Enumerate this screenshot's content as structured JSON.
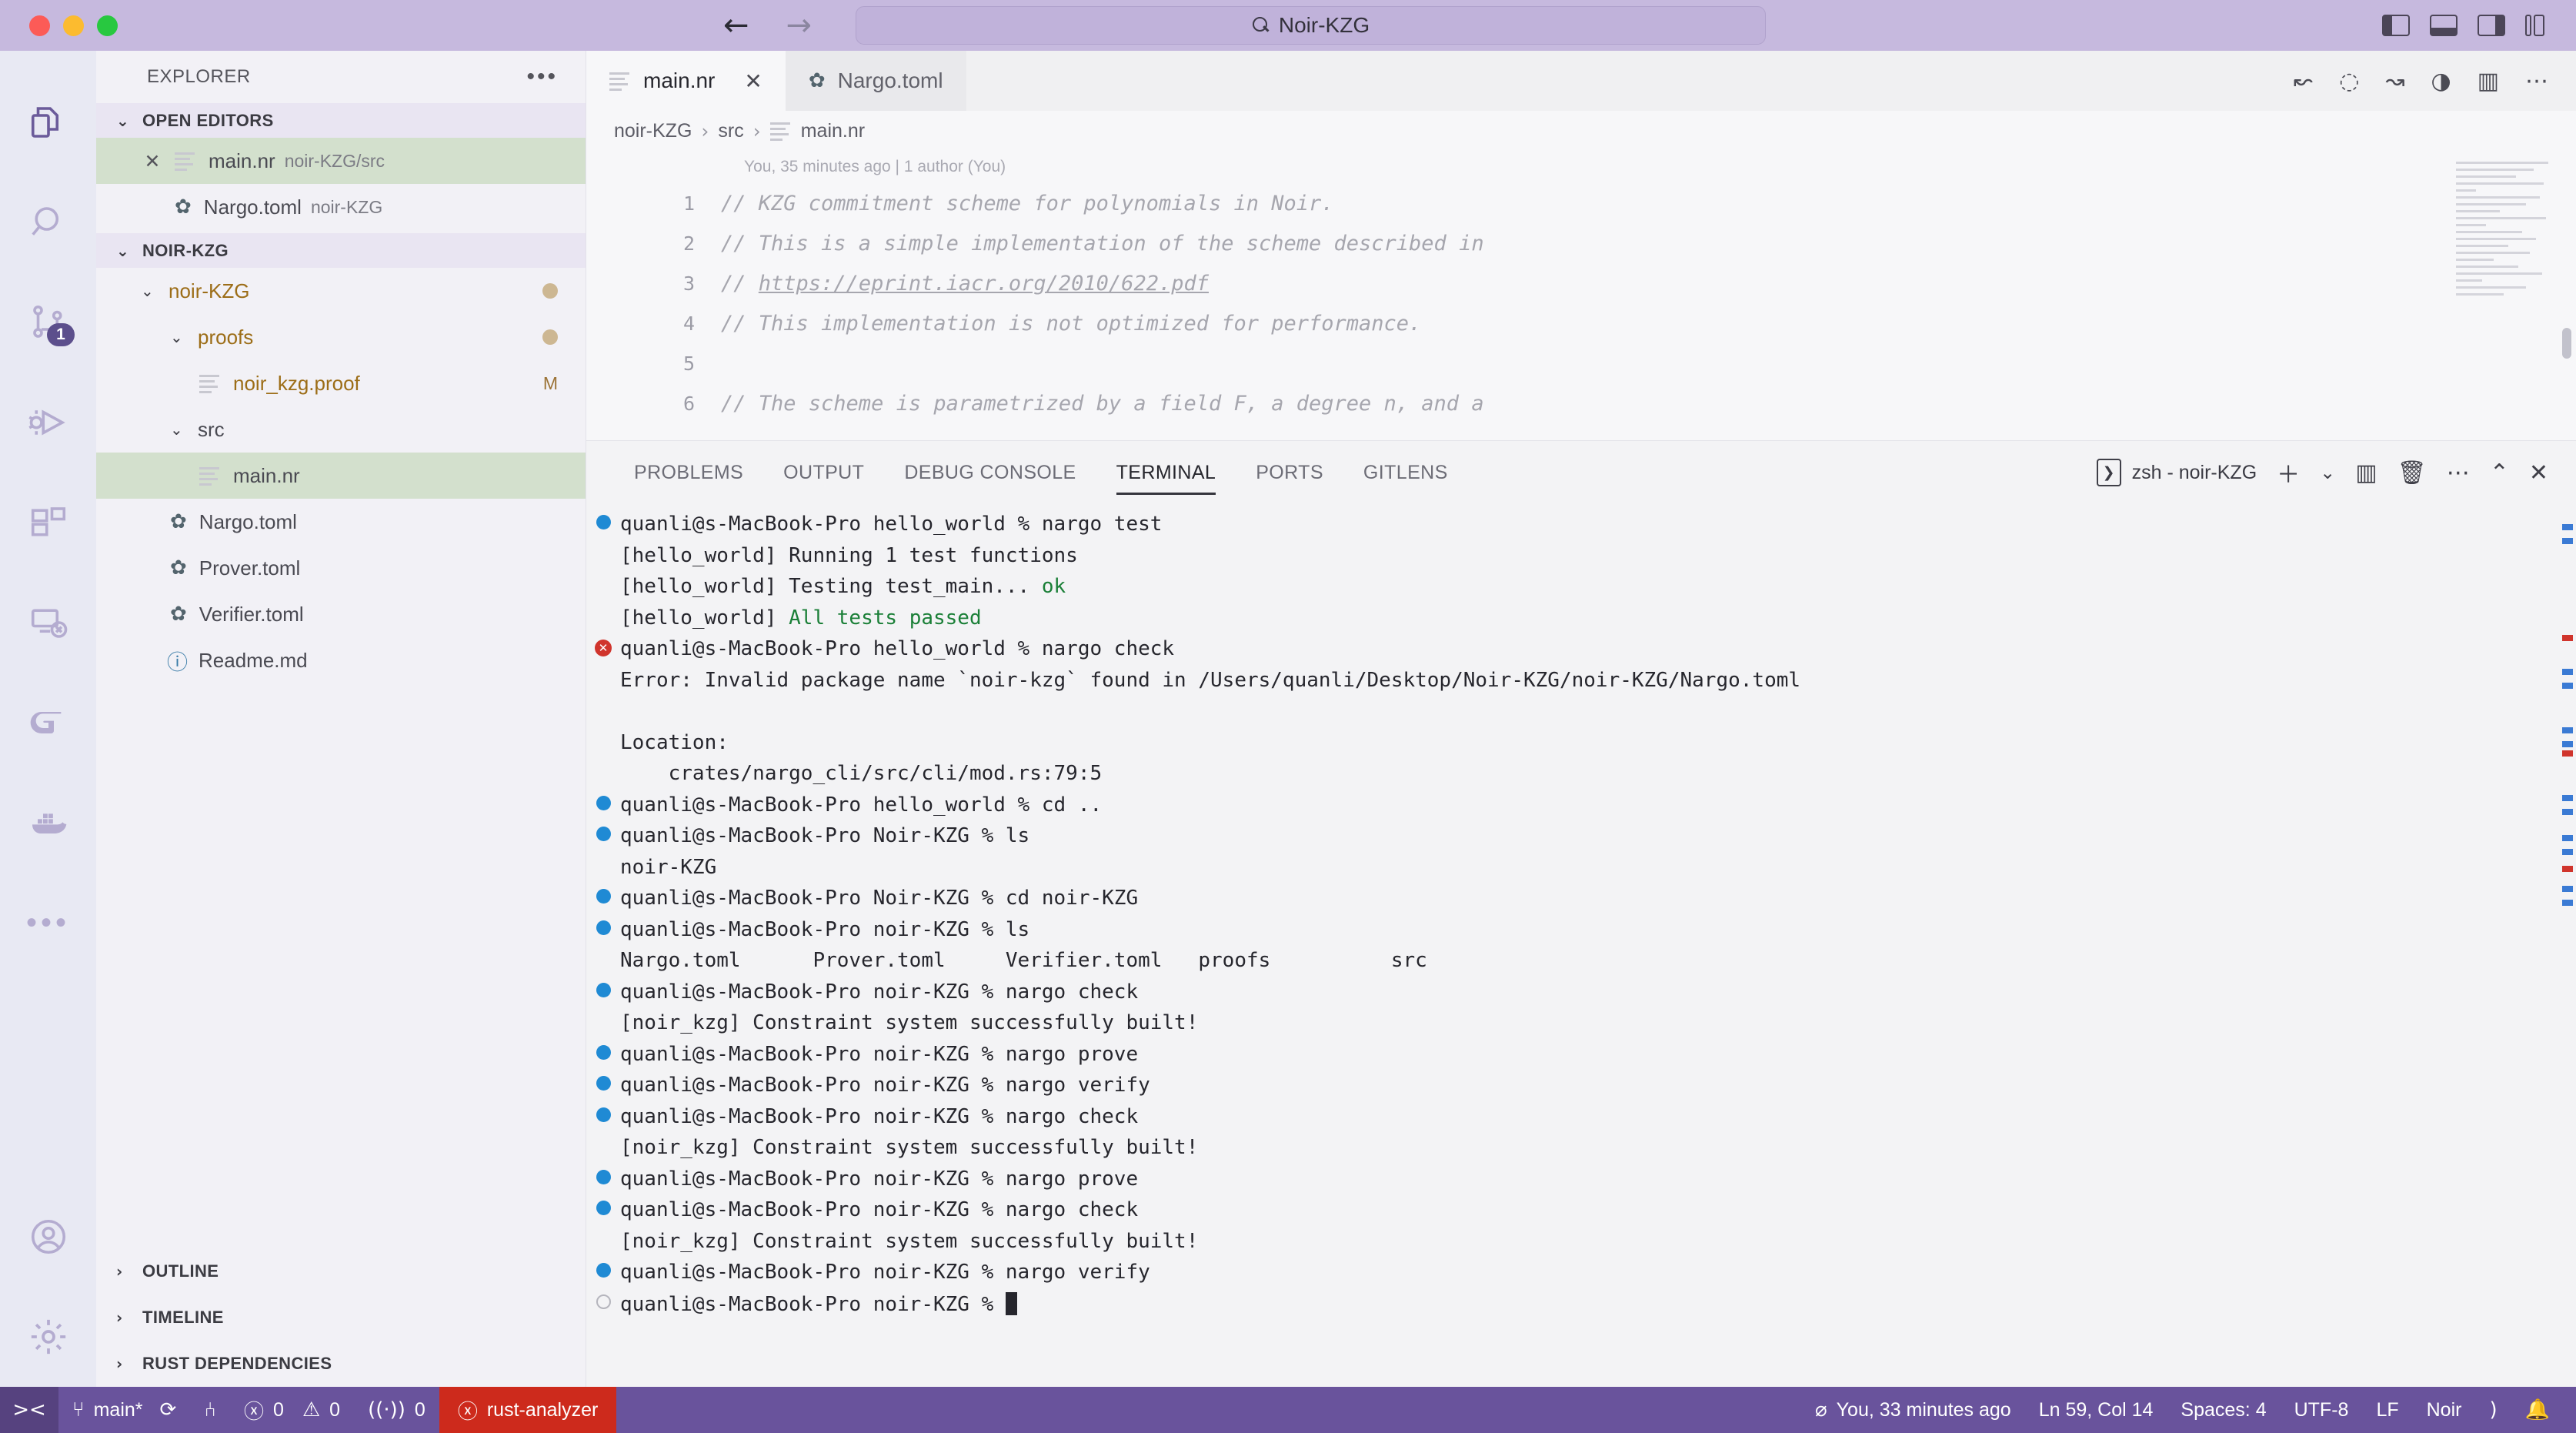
{
  "titlebar": {
    "command_center_text": "Noir-KZG",
    "search_icon": "search-icon",
    "back_arrow": "←",
    "forward_arrow": "→"
  },
  "activitybar": {
    "items": [
      {
        "name": "explorer",
        "icon": "files-icon",
        "badge": ""
      },
      {
        "name": "search",
        "icon": "search-icon",
        "badge": ""
      },
      {
        "name": "source-control",
        "icon": "source-control-icon",
        "badge": "1"
      },
      {
        "name": "run-and-debug",
        "icon": "debug-icon",
        "badge": ""
      },
      {
        "name": "extensions",
        "icon": "extensions-icon",
        "badge": ""
      },
      {
        "name": "remote-explorer",
        "icon": "remote-explorer-icon",
        "badge": ""
      },
      {
        "name": "gitlens",
        "icon": "gitlens-icon",
        "badge": ""
      },
      {
        "name": "docker",
        "icon": "docker-icon",
        "badge": ""
      },
      {
        "name": "more-views",
        "icon": "ellipsis-icon",
        "badge": ""
      }
    ],
    "bottom_items": [
      {
        "name": "accounts",
        "icon": "account-icon"
      },
      {
        "name": "manage",
        "icon": "gear-icon"
      }
    ]
  },
  "sidebar": {
    "title": "EXPLORER",
    "more_actions": "…",
    "open_editors": {
      "label": "OPEN EDITORS",
      "items": [
        {
          "name": "main.nr",
          "path": "noir-KZG/src",
          "icon": "file-icon",
          "selected": true,
          "closeable": true
        },
        {
          "name": "Nargo.toml",
          "path": "noir-KZG",
          "icon": "gear-icon",
          "selected": false,
          "closeable": false
        }
      ]
    },
    "workspace": {
      "label": "NOIR-KZG",
      "tree": [
        {
          "label": "noir-KZG",
          "type": "folder",
          "depth": 0,
          "expanded": true,
          "color": "amber",
          "dirty": true
        },
        {
          "label": "proofs",
          "type": "folder",
          "depth": 1,
          "expanded": true,
          "color": "amber",
          "dirty": true
        },
        {
          "label": "noir_kzg.proof",
          "type": "file",
          "depth": 2,
          "icon": "file-icon",
          "color": "amber",
          "git_status": "M"
        },
        {
          "label": "src",
          "type": "folder",
          "depth": 1,
          "expanded": true,
          "color": "grey"
        },
        {
          "label": "main.nr",
          "type": "file",
          "depth": 2,
          "icon": "file-icon",
          "color": "grey",
          "selected": true
        },
        {
          "label": "Nargo.toml",
          "type": "file",
          "depth": 1,
          "icon": "gear-icon",
          "color": "grey"
        },
        {
          "label": "Prover.toml",
          "type": "file",
          "depth": 1,
          "icon": "gear-icon",
          "color": "grey"
        },
        {
          "label": "Verifier.toml",
          "type": "file",
          "depth": 1,
          "icon": "gear-icon",
          "color": "grey"
        },
        {
          "label": "Readme.md",
          "type": "file",
          "depth": 1,
          "icon": "info-icon",
          "color": "grey"
        }
      ]
    },
    "collapsed_sections": [
      "OUTLINE",
      "TIMELINE",
      "RUST DEPENDENCIES"
    ]
  },
  "editor": {
    "tabs": [
      {
        "label": "main.nr",
        "icon": "file-icon",
        "active": true,
        "closeable": true
      },
      {
        "label": "Nargo.toml",
        "icon": "gear-icon",
        "active": false,
        "closeable": false
      }
    ],
    "tab_actions": [
      "go-back-icon",
      "circle-icon",
      "go-forward-icon",
      "history-icon",
      "split-editor-icon",
      "more-actions-icon"
    ],
    "breadcrumb": [
      "noir-KZG",
      "src",
      "main.nr"
    ],
    "breadcrumb_separator": "›",
    "blame": "You, 35 minutes ago | 1 author (You)",
    "lines": [
      {
        "num": "1",
        "text": "// KZG commitment scheme for polynomials in Noir.",
        "link": ""
      },
      {
        "num": "2",
        "text": "// This is a simple implementation of the scheme described in",
        "link": ""
      },
      {
        "num": "3",
        "text": "// ",
        "link": "https://eprint.iacr.org/2010/622.pdf"
      },
      {
        "num": "4",
        "text": "// This implementation is not optimized for performance.",
        "link": ""
      },
      {
        "num": "5",
        "text": "",
        "link": ""
      },
      {
        "num": "6",
        "text": "// The scheme is parametrized by a field F, a degree n, and a",
        "link": ""
      }
    ]
  },
  "panel": {
    "tabs": [
      {
        "label": "PROBLEMS",
        "active": false
      },
      {
        "label": "OUTPUT",
        "active": false
      },
      {
        "label": "DEBUG CONSOLE",
        "active": false
      },
      {
        "label": "TERMINAL",
        "active": true
      },
      {
        "label": "PORTS",
        "active": false
      },
      {
        "label": "GITLENS",
        "active": false
      }
    ],
    "terminal_name": "zsh - noir-KZG",
    "actions": [
      "new-terminal-icon",
      "chevron-down-icon",
      "split-terminal-icon",
      "trash-icon",
      "more-actions-icon",
      "chevron-up-icon",
      "close-icon"
    ],
    "terminal_lines": [
      {
        "marker": "blue",
        "text": "quanli@s-MacBook-Pro hello_world % nargo test"
      },
      {
        "marker": "none",
        "text": "[hello_world] Running 1 test functions"
      },
      {
        "marker": "none",
        "text": "[hello_world] Testing test_main... ",
        "green_tail": "ok"
      },
      {
        "marker": "none",
        "text": "[hello_world] ",
        "green_tail": "All tests passed"
      },
      {
        "marker": "error",
        "text": "quanli@s-MacBook-Pro hello_world % nargo check"
      },
      {
        "marker": "none",
        "text": "Error: Invalid package name `noir-kzg` found in /Users/quanli/Desktop/Noir-KZG/noir-KZG/Nargo.toml"
      },
      {
        "marker": "none",
        "text": ""
      },
      {
        "marker": "none",
        "text": "Location:"
      },
      {
        "marker": "none",
        "text": "    crates/nargo_cli/src/cli/mod.rs:79:5"
      },
      {
        "marker": "blue",
        "text": "quanli@s-MacBook-Pro hello_world % cd .."
      },
      {
        "marker": "blue",
        "text": "quanli@s-MacBook-Pro Noir-KZG % ls"
      },
      {
        "marker": "none",
        "text": "noir-KZG"
      },
      {
        "marker": "blue",
        "text": "quanli@s-MacBook-Pro Noir-KZG % cd noir-KZG"
      },
      {
        "marker": "blue",
        "text": "quanli@s-MacBook-Pro noir-KZG % ls"
      },
      {
        "marker": "none",
        "text": "Nargo.toml      Prover.toml     Verifier.toml   proofs          src"
      },
      {
        "marker": "blue",
        "text": "quanli@s-MacBook-Pro noir-KZG % nargo check"
      },
      {
        "marker": "none",
        "text": "[noir_kzg] Constraint system successfully built!"
      },
      {
        "marker": "blue",
        "text": "quanli@s-MacBook-Pro noir-KZG % nargo prove"
      },
      {
        "marker": "blue",
        "text": "quanli@s-MacBook-Pro noir-KZG % nargo verify"
      },
      {
        "marker": "blue",
        "text": "quanli@s-MacBook-Pro noir-KZG % nargo check"
      },
      {
        "marker": "none",
        "text": "[noir_kzg] Constraint system successfully built!"
      },
      {
        "marker": "blue",
        "text": "quanli@s-MacBook-Pro noir-KZG % nargo prove"
      },
      {
        "marker": "blue",
        "text": "quanli@s-MacBook-Pro noir-KZG % nargo check"
      },
      {
        "marker": "none",
        "text": "[noir_kzg] Constraint system successfully built!"
      },
      {
        "marker": "blue",
        "text": "quanli@s-MacBook-Pro noir-KZG % nargo verify"
      },
      {
        "marker": "grey",
        "text": "quanli@s-MacBook-Pro noir-KZG % ",
        "cursor": true
      }
    ]
  },
  "statusbar": {
    "remote_icon": "remote-window-icon",
    "branch": "main*",
    "sync_icon": "sync-icon",
    "branch_compare_icon": "compare-changes-icon",
    "errors": "0",
    "warnings": "0",
    "radio_tower_count": "0",
    "rust_analyzer": "rust-analyzer",
    "rust_analyzer_color": "#cd2a1c",
    "blame": "You, 33 minutes ago",
    "cursor_position": "Ln 59, Col 14",
    "indentation": "Spaces: 4",
    "encoding": "UTF-8",
    "eol": "LF",
    "language": "Noir",
    "bell_icon": "bell-icon",
    "accent": "#69539c"
  }
}
